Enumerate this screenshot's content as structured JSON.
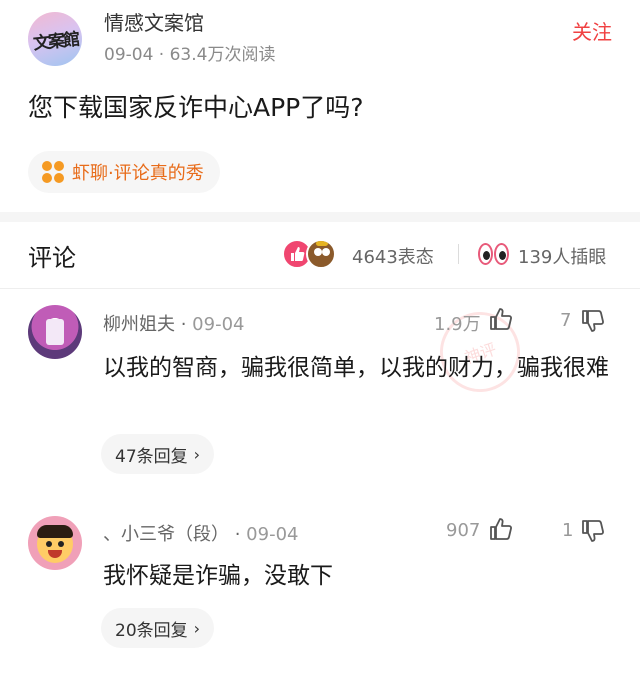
{
  "author": {
    "avatar_text": "文案館",
    "name": "情感文案馆",
    "meta": "09-04 · 63.4万次阅读",
    "follow_label": "关注"
  },
  "post": {
    "title": "您下载国家反诈中心APP了吗?"
  },
  "topic": {
    "icon": "flower-icon",
    "label": "虾聊·评论真的秀"
  },
  "comments_section": {
    "heading": "评论",
    "reaction_count": "4643表态",
    "insert_count": "139人插眼",
    "accent": "#f04670"
  },
  "comments": [
    {
      "name": "柳州姐夫 · ",
      "date": "09-04",
      "text": "以我的智商，骗我很简单，以我的财力，骗我很难",
      "likes": "1.9万",
      "dislikes": "7",
      "replies": "47条回复"
    },
    {
      "name": "、小三爷（段） · ",
      "date": "09-04",
      "text": "我怀疑是诈骗，没敢下",
      "likes": "907",
      "dislikes": "1",
      "replies": "20条回复"
    }
  ],
  "watermark": "神评",
  "colors": {
    "brand_red": "#f04142",
    "tag_orange": "#e86c1a"
  }
}
